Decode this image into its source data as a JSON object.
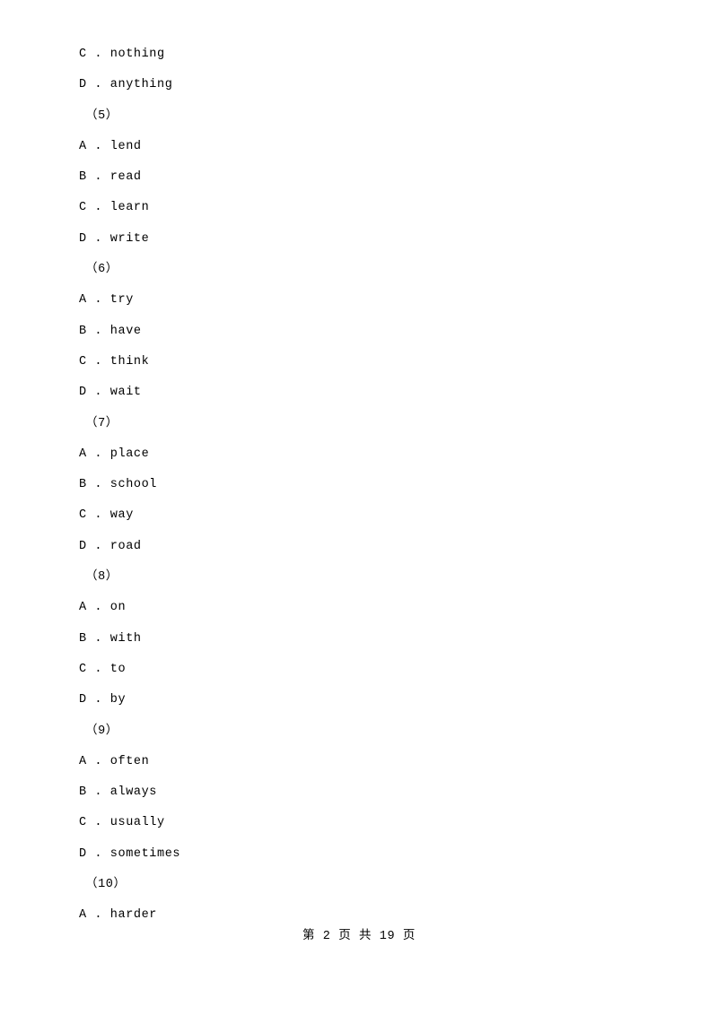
{
  "document": {
    "lines": [
      {
        "text": "C . nothing",
        "type": "option"
      },
      {
        "text": "D . anything",
        "type": "option"
      },
      {
        "text": "（5）",
        "type": "group"
      },
      {
        "text": "A . lend",
        "type": "option"
      },
      {
        "text": "B . read",
        "type": "option"
      },
      {
        "text": "C . learn",
        "type": "option"
      },
      {
        "text": "D . write",
        "type": "option"
      },
      {
        "text": "（6）",
        "type": "group"
      },
      {
        "text": "A . try",
        "type": "option"
      },
      {
        "text": "B . have",
        "type": "option"
      },
      {
        "text": "C . think",
        "type": "option"
      },
      {
        "text": "D . wait",
        "type": "option"
      },
      {
        "text": "（7）",
        "type": "group"
      },
      {
        "text": "A . place",
        "type": "option"
      },
      {
        "text": "B . school",
        "type": "option"
      },
      {
        "text": "C . way",
        "type": "option"
      },
      {
        "text": "D . road",
        "type": "option"
      },
      {
        "text": "（8）",
        "type": "group"
      },
      {
        "text": "A . on",
        "type": "option"
      },
      {
        "text": "B . with",
        "type": "option"
      },
      {
        "text": "C . to",
        "type": "option"
      },
      {
        "text": "D . by",
        "type": "option"
      },
      {
        "text": "（9）",
        "type": "group"
      },
      {
        "text": "A . often",
        "type": "option"
      },
      {
        "text": "B . always",
        "type": "option"
      },
      {
        "text": "C . usually",
        "type": "option"
      },
      {
        "text": "D . sometimes",
        "type": "option"
      },
      {
        "text": "（10）",
        "type": "group"
      },
      {
        "text": "A . harder",
        "type": "option"
      }
    ],
    "footer": "第 2 页 共 19 页"
  }
}
